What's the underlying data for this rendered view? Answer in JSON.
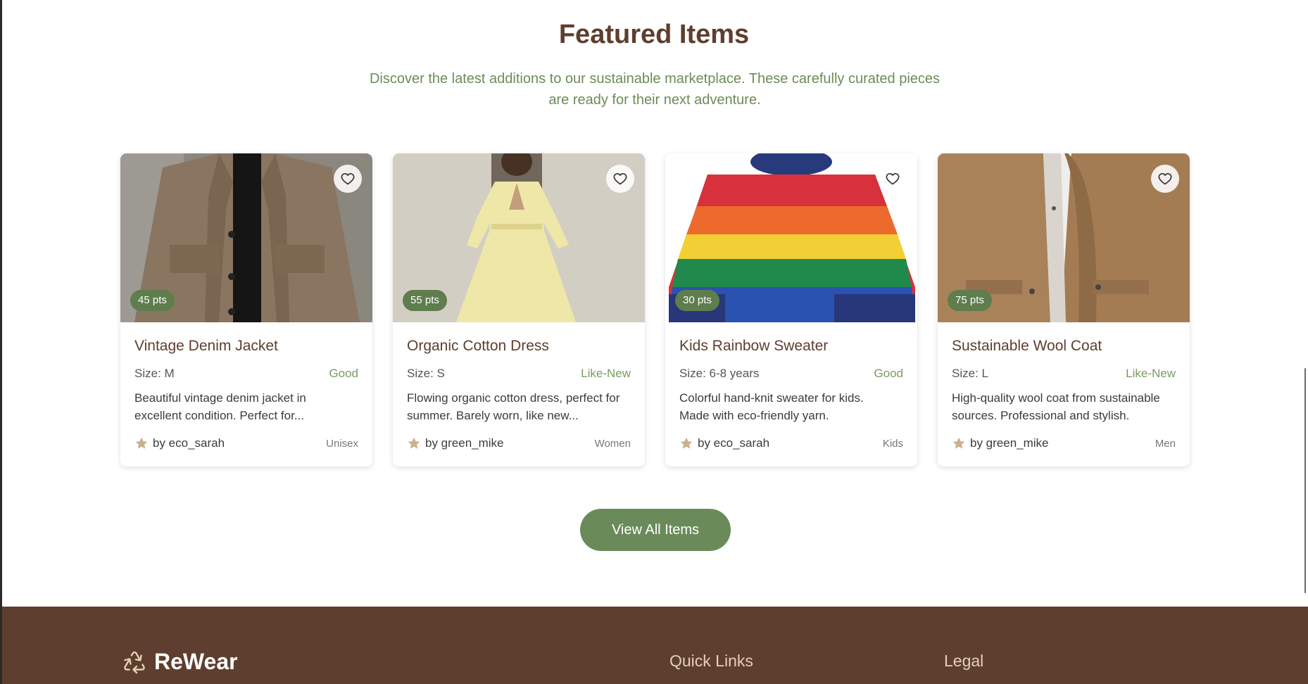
{
  "featured": {
    "title": "Featured Items",
    "subtitle_line1": "Discover the latest additions to our sustainable marketplace. These carefully curated pieces",
    "subtitle_line2": "are ready for their next adventure."
  },
  "items": [
    {
      "title": "Vintage Denim Jacket",
      "points": "45 pts",
      "size": "Size: M",
      "condition": "Good",
      "description_line1": "Beautiful vintage denim jacket in",
      "description_line2": "excellent condition. Perfect for...",
      "owner": "by eco_sarah",
      "category": "Unisex",
      "image_icon": "jacket-photo"
    },
    {
      "title": "Organic Cotton Dress",
      "points": "55 pts",
      "size": "Size: S",
      "condition": "Like-New",
      "description_line1": "Flowing organic cotton dress, perfect for",
      "description_line2": "summer. Barely worn, like new...",
      "owner": "by green_mike",
      "category": "Women",
      "image_icon": "dress-photo"
    },
    {
      "title": "Kids Rainbow Sweater",
      "points": "30 pts",
      "size": "Size: 6-8 years",
      "condition": "Good",
      "description_line1": "Colorful hand-knit sweater for kids.",
      "description_line2": "Made with eco-friendly yarn.",
      "owner": "by eco_sarah",
      "category": "Kids",
      "image_icon": "sweater-photo"
    },
    {
      "title": "Sustainable Wool Coat",
      "points": "75 pts",
      "size": "Size: L",
      "condition": "Like-New",
      "description_line1": "High-quality wool coat from sustainable",
      "description_line2": "sources. Professional and stylish.",
      "owner": "by green_mike",
      "category": "Men",
      "image_icon": "coat-photo"
    }
  ],
  "actions": {
    "view_all": "View All Items"
  },
  "footer": {
    "brand": "ReWear",
    "brand_icon": "recycle-icon",
    "quick_links": "Quick Links",
    "legal": "Legal"
  },
  "colors": {
    "brand_brown": "#5e3e2e",
    "accent_green": "#6a8a5a",
    "subtitle_green": "#6d8b57"
  }
}
